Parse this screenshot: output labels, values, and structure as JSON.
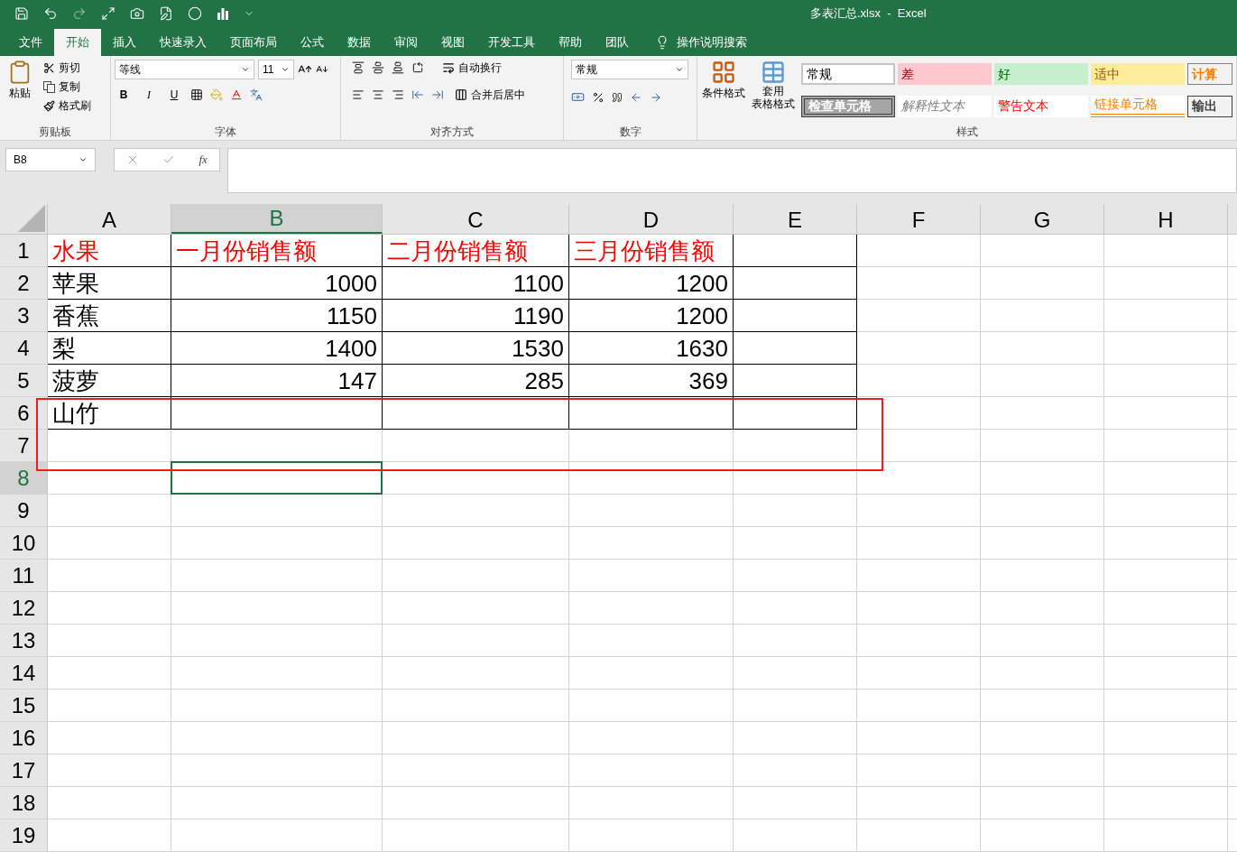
{
  "window": {
    "title": "多表汇总.xlsx  -  Excel"
  },
  "menu_tabs": [
    {
      "label": "文件",
      "selected": false
    },
    {
      "label": "开始",
      "selected": true
    },
    {
      "label": "插入",
      "selected": false
    },
    {
      "label": "快速录入",
      "selected": false
    },
    {
      "label": "页面布局",
      "selected": false
    },
    {
      "label": "公式",
      "selected": false
    },
    {
      "label": "数据",
      "selected": false
    },
    {
      "label": "审阅",
      "selected": false
    },
    {
      "label": "视图",
      "selected": false
    },
    {
      "label": "开发工具",
      "selected": false
    },
    {
      "label": "帮助",
      "selected": false
    },
    {
      "label": "团队",
      "selected": false
    }
  ],
  "tell_me": "操作说明搜索",
  "clipboard": {
    "paste": "粘贴",
    "cut": "剪切",
    "copy": "复制",
    "format_painter": "格式刷",
    "label": "剪贴板"
  },
  "font": {
    "name": "等线",
    "size": "11",
    "bold": "B",
    "italic": "I",
    "underline": "U",
    "label": "字体"
  },
  "alignment": {
    "wrap": "自动换行",
    "merge": "合并后居中",
    "label": "对齐方式"
  },
  "number": {
    "format": "常规",
    "label": "数字"
  },
  "styles": {
    "conditional": "条件格式",
    "table_format": [
      "套用",
      "表格格式"
    ],
    "label": "样式",
    "cell_styles": [
      {
        "text": "常规",
        "kind": "normal"
      },
      {
        "text": "差",
        "kind": "bad"
      },
      {
        "text": "好",
        "kind": "good"
      },
      {
        "text": "适中",
        "kind": "neutral"
      },
      {
        "text": "计算",
        "kind": "calculation"
      },
      {
        "text": "检查单元格",
        "kind": "check"
      },
      {
        "text": "解释性文本",
        "kind": "explanatory"
      },
      {
        "text": "警告文本",
        "kind": "warning"
      },
      {
        "text": "链接单元格",
        "kind": "linked"
      },
      {
        "text": "输出",
        "kind": "output"
      }
    ]
  },
  "formula_bar": {
    "name_box": "B8",
    "function_button": "fx"
  },
  "columns": [
    {
      "label": "A",
      "selected": false
    },
    {
      "label": "B",
      "selected": true
    },
    {
      "label": "C",
      "selected": false
    },
    {
      "label": "D",
      "selected": false
    },
    {
      "label": "E",
      "selected": false
    },
    {
      "label": "F",
      "selected": false
    },
    {
      "label": "G",
      "selected": false
    },
    {
      "label": "H",
      "selected": false
    }
  ],
  "rows": [
    {
      "header": "1",
      "selected": false,
      "bordered": true,
      "cells": [
        {
          "kind": "heading",
          "text": "水果"
        },
        {
          "kind": "heading",
          "text": "一月份销售额"
        },
        {
          "kind": "heading",
          "text": "二月份销售额"
        },
        {
          "kind": "heading",
          "text": "三月份销售额"
        }
      ]
    },
    {
      "header": "2",
      "selected": false,
      "bordered": true,
      "cells": [
        {
          "kind": "text",
          "text": "苹果"
        },
        {
          "kind": "number",
          "text": "1000"
        },
        {
          "kind": "number",
          "text": "1100"
        },
        {
          "kind": "number",
          "text": "1200"
        }
      ]
    },
    {
      "header": "3",
      "selected": false,
      "bordered": true,
      "cells": [
        {
          "kind": "text",
          "text": "香蕉"
        },
        {
          "kind": "number",
          "text": "1150"
        },
        {
          "kind": "number",
          "text": "1190"
        },
        {
          "kind": "number",
          "text": "1200"
        }
      ]
    },
    {
      "header": "4",
      "selected": false,
      "bordered": true,
      "cells": [
        {
          "kind": "text",
          "text": "梨"
        },
        {
          "kind": "number",
          "text": "1400"
        },
        {
          "kind": "number",
          "text": "1530"
        },
        {
          "kind": "number",
          "text": "1630"
        }
      ]
    },
    {
      "header": "5",
      "selected": false,
      "bordered": true,
      "cells": [
        {
          "kind": "text",
          "text": "菠萝"
        },
        {
          "kind": "number",
          "text": "147"
        },
        {
          "kind": "number",
          "text": "285"
        },
        {
          "kind": "number",
          "text": "369"
        }
      ]
    },
    {
      "header": "6",
      "selected": false,
      "bordered": true,
      "cells": [
        {
          "kind": "text",
          "text": "山竹"
        }
      ]
    },
    {
      "header": "7",
      "selected": false,
      "bordered": false,
      "cells": []
    },
    {
      "header": "8",
      "selected": true,
      "bordered": false,
      "cells": []
    },
    {
      "header": "9",
      "selected": false,
      "bordered": false,
      "cells": []
    },
    {
      "header": "10",
      "selected": false,
      "bordered": false,
      "cells": []
    },
    {
      "header": "11",
      "selected": false,
      "bordered": false,
      "cells": []
    },
    {
      "header": "12",
      "selected": false,
      "bordered": false,
      "cells": []
    },
    {
      "header": "13",
      "selected": false,
      "bordered": false,
      "cells": []
    },
    {
      "header": "14",
      "selected": false,
      "bordered": false,
      "cells": []
    },
    {
      "header": "15",
      "selected": false,
      "bordered": false,
      "cells": []
    },
    {
      "header": "16",
      "selected": false,
      "bordered": false,
      "cells": []
    },
    {
      "header": "17",
      "selected": false,
      "bordered": false,
      "cells": []
    },
    {
      "header": "18",
      "selected": false,
      "bordered": false,
      "cells": []
    },
    {
      "header": "19",
      "selected": false,
      "bordered": false,
      "cells": []
    }
  ],
  "annotation": {
    "kind": "rectangle",
    "color": "#ee1c1c"
  }
}
